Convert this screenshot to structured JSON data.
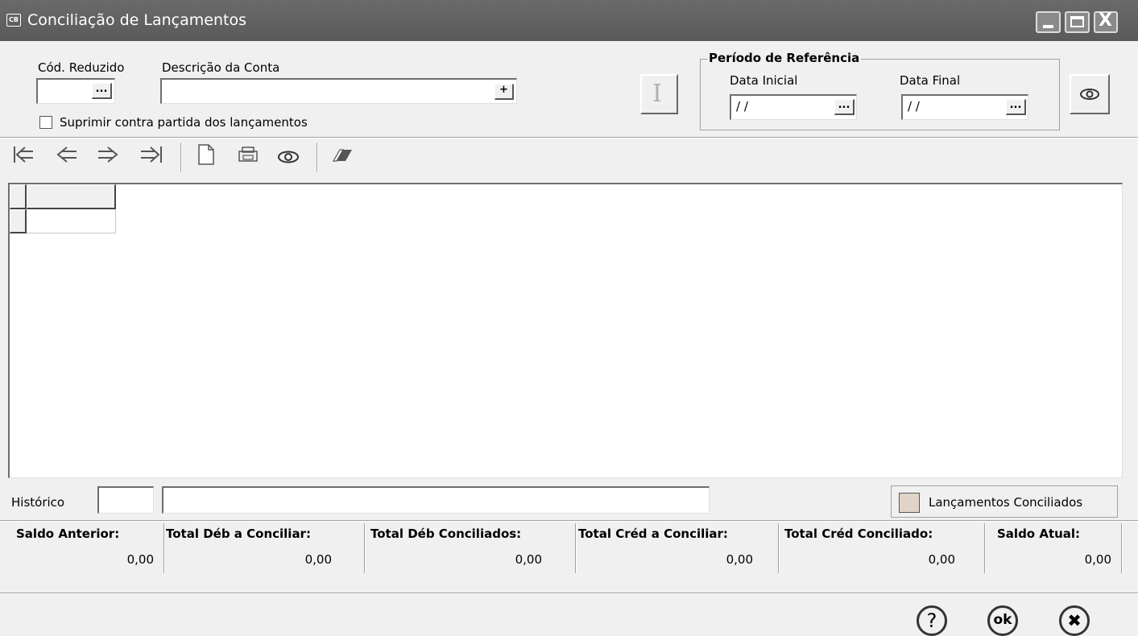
{
  "window": {
    "app_icon_text": "CB",
    "title": "Conciliação de Lançamentos"
  },
  "filters": {
    "cod_reduzido_label": "Cód. Reduzido",
    "descricao_label": "Descrição da Conta",
    "cod_reduzido_value": "",
    "descricao_value": "",
    "lookup_btn": "...",
    "add_btn": "+",
    "suprimir_label": "Suprimir contra partida dos lançamentos",
    "suprimir_checked": false
  },
  "periodo": {
    "title": "Período de Referência",
    "data_inicial_label": "Data Inicial",
    "data_final_label": "Data Final",
    "data_inicial_value": "/ /",
    "data_final_value": "/ /",
    "lookup_btn": "..."
  },
  "toolbar": {
    "first": "first-record-icon",
    "prev": "previous-record-icon",
    "next": "next-record-icon",
    "last": "last-record-icon",
    "new": "new-document-icon",
    "print": "printer-icon",
    "view": "eye-icon",
    "clear": "eraser-icon"
  },
  "historico": {
    "label": "Histórico",
    "code_value": "",
    "text_value": ""
  },
  "legend": {
    "label": "Lançamentos Conciliados",
    "color": "#e0d4c8"
  },
  "totals": [
    {
      "label": "Saldo Anterior:",
      "value": "0,00"
    },
    {
      "label": "Total Déb a Conciliar:",
      "value": "0,00"
    },
    {
      "label": "Total Déb Conciliados:",
      "value": "0,00"
    },
    {
      "label": "Total Créd a Conciliar:",
      "value": "0,00"
    },
    {
      "label": "Total Créd Conciliado:",
      "value": "0,00"
    },
    {
      "label": "Saldo Atual:",
      "value": "0,00"
    }
  ],
  "footer": {
    "help": "?",
    "ok": "ok",
    "cancel": "✖"
  }
}
